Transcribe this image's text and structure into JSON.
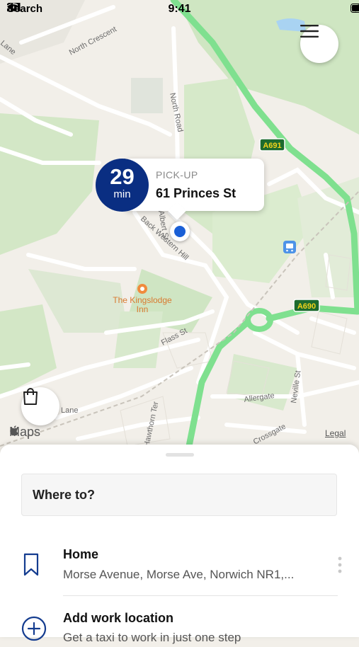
{
  "status_bar": {
    "back_label": "Search",
    "time": "9:41"
  },
  "map": {
    "road_labels": [
      "North Crescent",
      "North Road",
      "Back Western Hill",
      "Flass St",
      "Allergate",
      "Neville St",
      "Crossgate",
      "Lane",
      "Lane",
      "Albert St",
      "Hawthorn Ter"
    ],
    "road_badges": [
      "A691",
      "A690"
    ],
    "poi_name_line1": "The Kingslodge",
    "poi_name_line2": "Inn",
    "attribution": "Maps",
    "legal": "Legal"
  },
  "pickup": {
    "eta_value": "29",
    "eta_unit": "min",
    "label": "PICK-UP",
    "address": "61 Princes St"
  },
  "sheet": {
    "search_label": "Where to?",
    "items": [
      {
        "title": "Home",
        "subtitle": "Morse Avenue, Morse Ave, Norwich NR1,...",
        "icon": "bookmark-icon"
      },
      {
        "title": "Add work location",
        "subtitle": "Get a taxi to work in just one step",
        "icon": "plus-circle-icon"
      }
    ]
  },
  "colors": {
    "brand": "#0a2e82",
    "route_green": "#7fe08f",
    "location_blue": "#1a5fd6"
  }
}
